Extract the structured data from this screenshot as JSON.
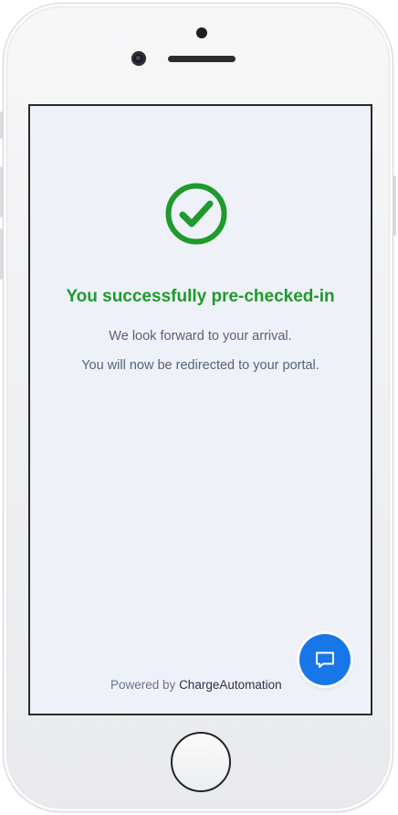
{
  "success": {
    "title": "You successfully pre-checked-in",
    "message_line1": "We look forward to your arrival.",
    "message_line2": "You will now be redirected to your portal.",
    "icon": "check-circle-icon",
    "accent_color": "#1f9a2b"
  },
  "footer": {
    "powered_prefix": "Powered by",
    "brand": "ChargeAutomation"
  },
  "chat": {
    "icon": "chat-bubble-icon",
    "color": "#1877e8"
  }
}
